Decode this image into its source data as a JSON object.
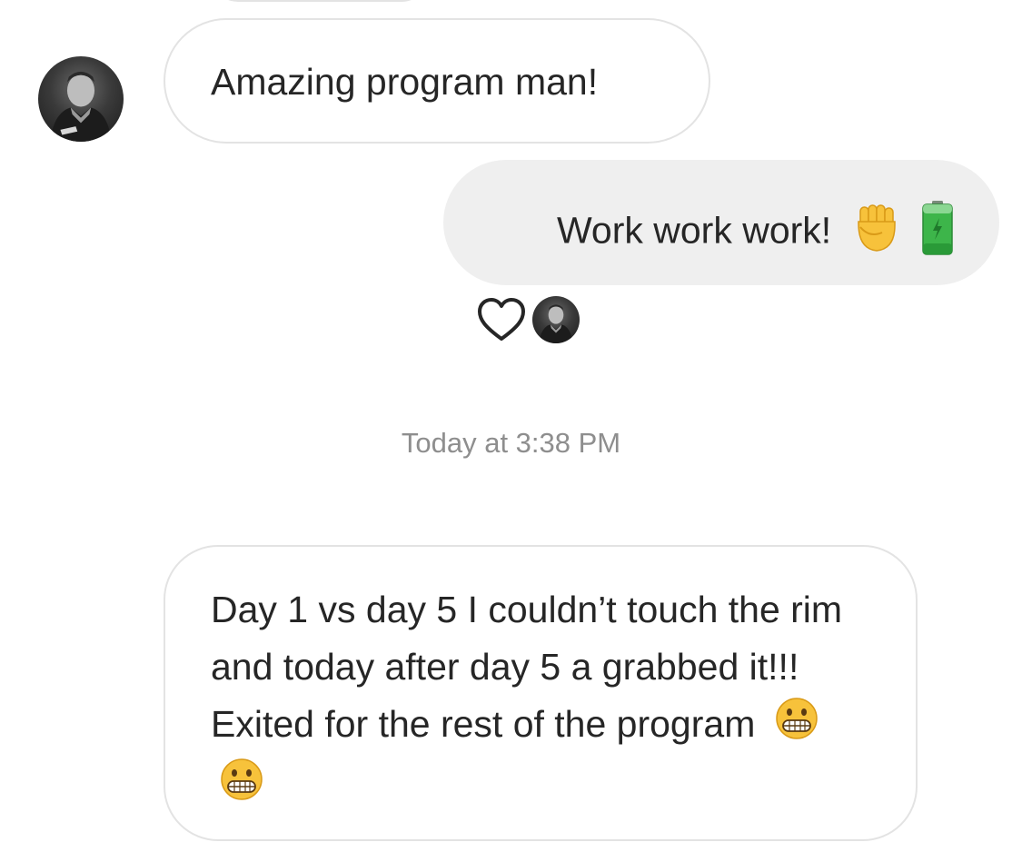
{
  "thread": {
    "messages": [
      {
        "sender": "other",
        "text": "Amazing program man!",
        "emoji": []
      },
      {
        "sender": "self",
        "text": "Work work work!",
        "emoji": [
          "raised-fist",
          "battery"
        ]
      },
      {
        "sender": "other",
        "text": "Day 1 vs day 5 I couldn’t touch the rim and today after day 5 a grabbed it!!! Exited for the rest of the program",
        "emoji": [
          "grimacing-face",
          "grimacing-face"
        ]
      }
    ],
    "reaction": {
      "icon": "heart-outline-icon"
    },
    "timestamp": "Today at 3:38 PM"
  },
  "colors": {
    "incoming_border": "#e3e3e3",
    "outgoing_bg": "#efefef",
    "timestamp_text": "#8e8e8e",
    "text": "#262626"
  }
}
